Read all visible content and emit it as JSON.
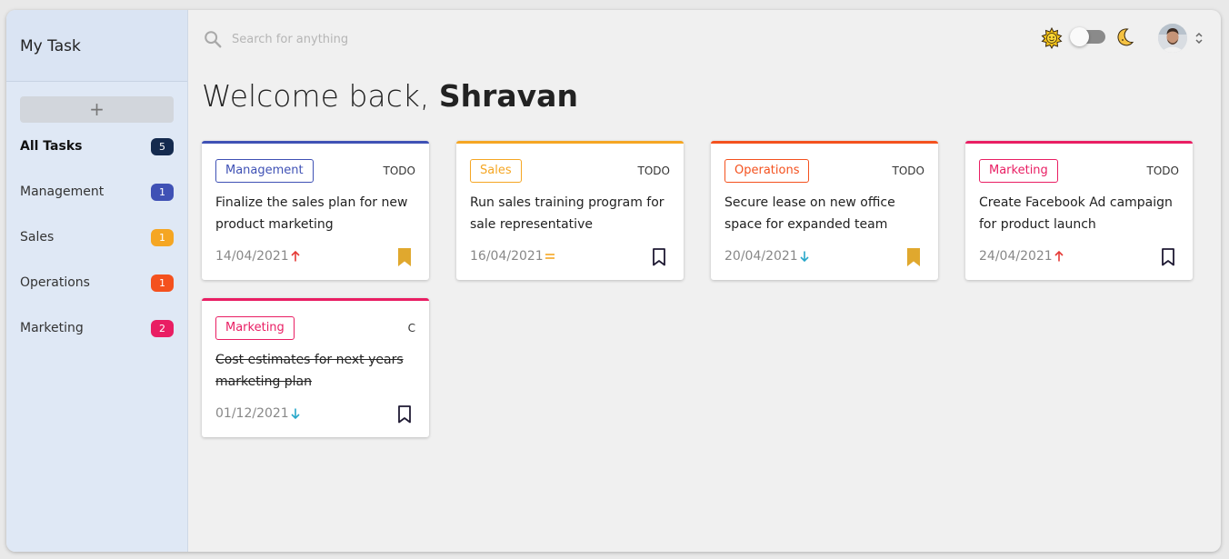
{
  "app": {
    "title": "My Task"
  },
  "sidebar": {
    "add_label": "+",
    "items": [
      {
        "label": "All Tasks",
        "count": "5",
        "color": "#142a4e",
        "active": true
      },
      {
        "label": "Management",
        "count": "1",
        "color": "#3f51b5"
      },
      {
        "label": "Sales",
        "count": "1",
        "color": "#f5a623"
      },
      {
        "label": "Operations",
        "count": "1",
        "color": "#f4511e"
      },
      {
        "label": "Marketing",
        "count": "2",
        "color": "#e91e63"
      }
    ]
  },
  "header": {
    "search_placeholder": "Search for anything",
    "theme": {
      "light_icon": "sun-icon",
      "dark_icon": "moon-icon",
      "dark_mode": false
    }
  },
  "welcome": {
    "greeting": "Welcome back,",
    "name": "Shravan"
  },
  "tasks": [
    {
      "category": "Management",
      "color": "#3f51b5",
      "status": "TODO",
      "title": "Finalize the sales plan for new product marketing",
      "date": "14/04/2021",
      "priority": "high",
      "bookmarked": true,
      "completed": false
    },
    {
      "category": "Sales",
      "color": "#f5a623",
      "status": "TODO",
      "title": "Run sales training program for sale representative",
      "date": "16/04/2021",
      "priority": "medium",
      "bookmarked": false,
      "completed": false
    },
    {
      "category": "Operations",
      "color": "#f4511e",
      "status": "TODO",
      "title": "Secure lease on new office space for expanded team",
      "date": "20/04/2021",
      "priority": "low",
      "bookmarked": true,
      "completed": false
    },
    {
      "category": "Marketing",
      "color": "#e91e63",
      "status": "TODO",
      "title": "Create Facebook Ad campaign for product launch",
      "date": "24/04/2021",
      "priority": "high",
      "bookmarked": false,
      "completed": false
    },
    {
      "category": "Marketing",
      "color": "#e91e63",
      "status": "C",
      "title": "Cost estimates for next years marketing plan",
      "date": "01/12/2021",
      "priority": "low",
      "bookmarked": false,
      "completed": true
    }
  ],
  "colors": {
    "priority_high": "#e53935",
    "priority_medium": "#f5a623",
    "priority_low": "#26a6c9",
    "bookmark_filled": "#e0a82e",
    "bookmark_outline": "#1f1a33"
  }
}
